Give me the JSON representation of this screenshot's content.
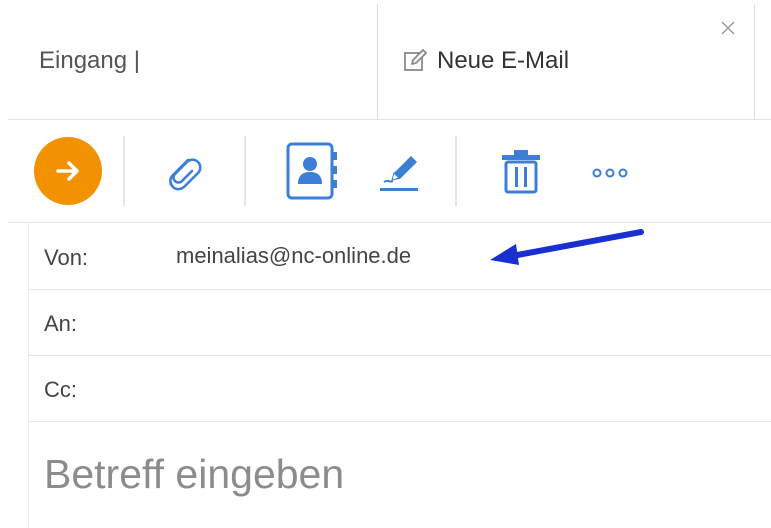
{
  "tabs": {
    "inbox_label": "Eingang |",
    "compose_label": "Neue E-Mail"
  },
  "icons": {
    "compose_tab": "edit-icon",
    "close": "close-icon",
    "send": "arrow-right-icon",
    "attach": "paperclip-icon",
    "address_book": "address-book-icon",
    "signature": "signature-icon",
    "delete": "trash-icon",
    "more": "more-icon"
  },
  "colors": {
    "send_button": "#f39200",
    "icon_blue": "#3d7fd6",
    "annotation_arrow": "#1a2fd0"
  },
  "fields": {
    "from_label": "Von:",
    "from_value": "meinalias@nc-online.de",
    "to_label": "An:",
    "to_value": "",
    "cc_label": "Cc:",
    "cc_value": ""
  },
  "subject": {
    "placeholder": "Betreff eingeben"
  }
}
